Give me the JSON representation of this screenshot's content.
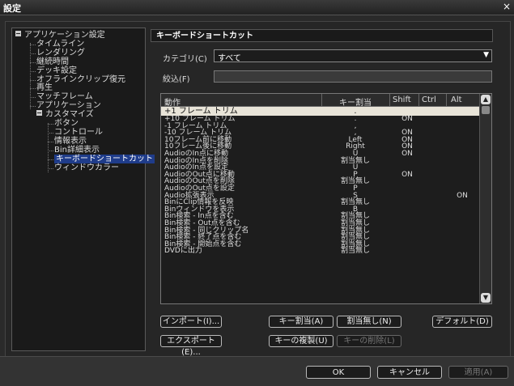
{
  "window": {
    "title": "設定",
    "close": "×"
  },
  "tree": {
    "items": [
      {
        "label": "アプリケーション設定",
        "level": 0,
        "expander": true
      },
      {
        "label": "タイムライン",
        "level": 1
      },
      {
        "label": "レンダリング",
        "level": 1
      },
      {
        "label": "継続時間",
        "level": 1
      },
      {
        "label": "デッキ設定",
        "level": 1
      },
      {
        "label": "オフラインクリップ復元",
        "level": 1
      },
      {
        "label": "再生",
        "level": 1
      },
      {
        "label": "マッチフレーム",
        "level": 1
      },
      {
        "label": "アプリケーション",
        "level": 1
      },
      {
        "label": "カスタマイズ",
        "level": 1,
        "expander": true
      },
      {
        "label": "ボタン",
        "level": 2
      },
      {
        "label": "コントロール",
        "level": 2
      },
      {
        "label": "情報表示",
        "level": 2
      },
      {
        "label": "Bin詳細表示",
        "level": 2
      },
      {
        "label": "キーボードショートカット",
        "level": 2,
        "selected": true
      },
      {
        "label": "ウィンドウカラー",
        "level": 2
      }
    ]
  },
  "panel": {
    "title": "キーボードショートカット",
    "category_label": "カテゴリ(C)",
    "category_value": "すべて",
    "filter_label": "絞込(F)",
    "filter_value": ""
  },
  "list": {
    "headers": [
      "動作",
      "キー割当",
      "Shift",
      "Ctrl",
      "Alt"
    ],
    "rows": [
      [
        "+1 フレーム トリム",
        ".",
        "",
        "",
        ""
      ],
      [
        "+10 フレーム トリム",
        ".",
        "ON",
        "",
        ""
      ],
      [
        "-1 フレーム トリム",
        ",",
        "",
        "",
        ""
      ],
      [
        "-10 フレーム トリム",
        ",",
        "ON",
        "",
        ""
      ],
      [
        "10フレーム前に移動",
        "Left",
        "ON",
        "",
        ""
      ],
      [
        "10フレーム後に移動",
        "Right",
        "ON",
        "",
        ""
      ],
      [
        "AudioのIn点に移動",
        "U",
        "ON",
        "",
        ""
      ],
      [
        "AudioのIn点を削除",
        "割当無し",
        "",
        "",
        ""
      ],
      [
        "AudioのIn点を設定",
        "U",
        "",
        "",
        ""
      ],
      [
        "AudioのOut点に移動",
        "P",
        "ON",
        "",
        ""
      ],
      [
        "AudioのOut点を削除",
        "割当無し",
        "",
        "",
        ""
      ],
      [
        "AudioのOut点を設定",
        "P",
        "",
        "",
        ""
      ],
      [
        "Audio拡張表示",
        "S",
        "",
        "",
        "ON"
      ],
      [
        "BinにClip情報を反映",
        "割当無し",
        "",
        "",
        ""
      ],
      [
        "Binウィンドウを表示",
        "B",
        "",
        "",
        ""
      ],
      [
        "Bin検索 - In点を含む",
        "割当無し",
        "",
        "",
        ""
      ],
      [
        "Bin検索 - Out点を含む",
        "割当無し",
        "",
        "",
        ""
      ],
      [
        "Bin検索 - 同じクリップ名",
        "割当無し",
        "",
        "",
        ""
      ],
      [
        "Bin検索 - 終了点を含む",
        "割当無し",
        "",
        "",
        ""
      ],
      [
        "Bin検索 - 開始点を含む",
        "割当無し",
        "",
        "",
        ""
      ],
      [
        "DVDに出力",
        "割当無し",
        "",
        "",
        ""
      ]
    ]
  },
  "buttons": {
    "import": "インポート(I)...",
    "export": "エクスポート(E)...",
    "assign_key": "キー割当(A)",
    "unassign": "割当無し(N)",
    "duplicate_key": "キーの複製(U)",
    "delete_key": "キーの削除(L)",
    "default": "デフォルト(D)",
    "ok": "OK",
    "cancel": "キャンセル",
    "apply": "適用(A)"
  }
}
